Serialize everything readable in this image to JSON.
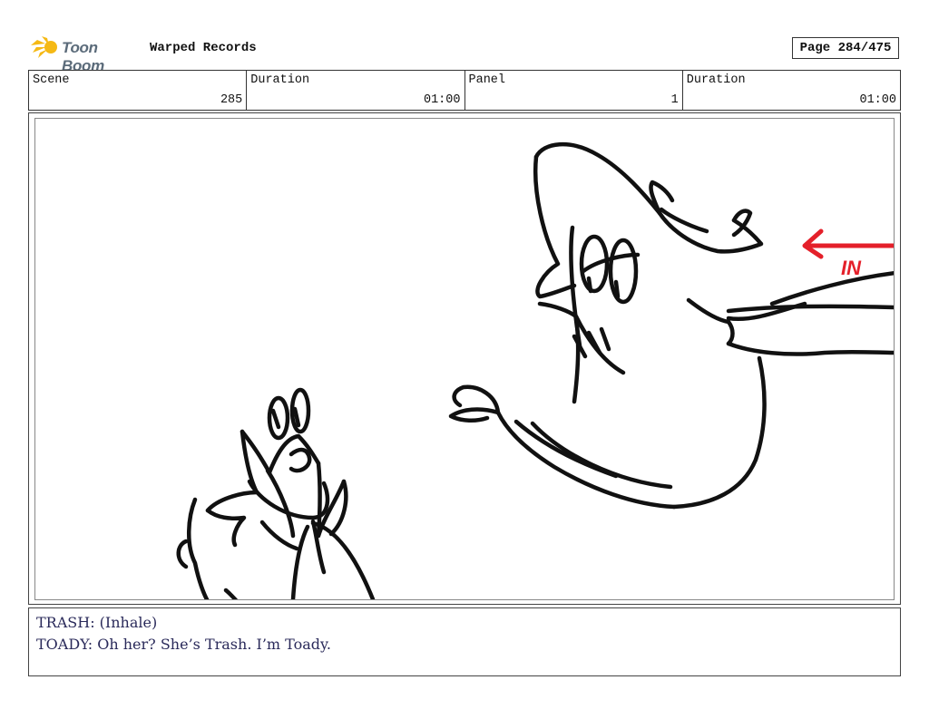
{
  "header": {
    "logo_text": "Toon Boom",
    "project_title": "Warped Records",
    "page_label": "Page 284/475"
  },
  "info_bar": {
    "scene": {
      "label": "Scene",
      "value": "285"
    },
    "scene_duration": {
      "label": "Duration",
      "value": "01:00"
    },
    "panel": {
      "label": "Panel",
      "value": "1"
    },
    "panel_duration": {
      "label": "Duration",
      "value": "01:00"
    }
  },
  "drawing": {
    "annotation_text": "IN",
    "annotation_color": "#e4202a",
    "line_color": "#111111"
  },
  "dialogue": {
    "lines": [
      "TRASH: (Inhale)",
      "TOADY: Oh her? She’s Trash. I’m Toady."
    ]
  },
  "colors": {
    "logo_accent": "#f5b915",
    "dialogue_text": "#2a2a5a"
  }
}
